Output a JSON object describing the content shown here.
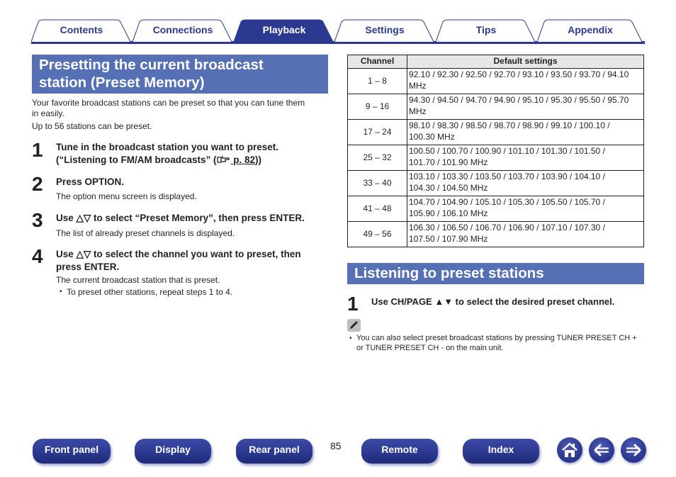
{
  "tabs": [
    {
      "label": "Contents",
      "active": false
    },
    {
      "label": "Connections",
      "active": false
    },
    {
      "label": "Playback",
      "active": true
    },
    {
      "label": "Settings",
      "active": false
    },
    {
      "label": "Tips",
      "active": false
    },
    {
      "label": "Appendix",
      "active": false
    }
  ],
  "left": {
    "heading_line1": "Presetting the current broadcast",
    "heading_line2": "station (Preset Memory)",
    "intro_line1": "Your favorite broadcast stations can be preset so that you can tune them",
    "intro_line2": "in easily.",
    "intro_line3": "Up to 56 stations can be preset.",
    "steps": [
      {
        "num": "1",
        "title_line1": "Tune in the broadcast station you want to preset.",
        "title_line2_pre": "(“Listening to FM/AM broadcasts” (",
        "ref_icon": "pointing-hand-icon",
        "link": " p. 82",
        "title_line2_post": "))"
      },
      {
        "num": "2",
        "title": "Press OPTION.",
        "desc": "The option menu screen is displayed."
      },
      {
        "num": "3",
        "title": "Use △▽ to select “Preset Memory”, then press ENTER.",
        "desc": "The list of already preset channels is displayed."
      },
      {
        "num": "4",
        "title_line1": "Use △▽ to select the channel you want to preset, then",
        "title_line2": "press ENTER.",
        "desc": "The current broadcast station that is preset.",
        "bullet": "To preset other stations, repeat steps 1 to 4."
      }
    ]
  },
  "table": {
    "headers": [
      "Channel",
      "Default settings"
    ],
    "rows": [
      {
        "channel": "1 – 8",
        "line1": "92.10 / 92.30 / 92.50 / 92.70 / 93.10 / 93.50 / 93.70 / 94.10",
        "line2": "MHz"
      },
      {
        "channel": "9 – 16",
        "line1": "94.30 / 94.50 / 94.70 / 94.90 / 95.10 / 95.30 / 95.50 / 95.70",
        "line2": "MHz"
      },
      {
        "channel": "17 – 24",
        "line1": "98.10 / 98.30 / 98.50 / 98.70 / 98.90 / 99.10 / 100.10 /",
        "line2": "100.30 MHz"
      },
      {
        "channel": "25 – 32",
        "line1": "100.50 / 100.70 / 100.90 / 101.10 / 101.30 / 101.50 /",
        "line2": "101.70 / 101.90 MHz"
      },
      {
        "channel": "33 – 40",
        "line1": "103.10 / 103.30 / 103.50 / 103.70 / 103.90 / 104.10 /",
        "line2": "104.30 / 104.50 MHz"
      },
      {
        "channel": "41 – 48",
        "line1": "104.70 / 104.90 / 105.10 / 105.30 / 105.50 / 105.70 /",
        "line2": "105.90 / 106.10 MHz"
      },
      {
        "channel": "49 – 56",
        "line1": "106.30 / 106.50 / 106.70 / 106.90 / 107.10 / 107.30 /",
        "line2": "107.50 / 107.90 MHz"
      }
    ]
  },
  "right": {
    "heading": "Listening to preset stations",
    "step_num": "1",
    "step_title": "Use CH/PAGE ▲▼ to select the desired preset channel.",
    "note_icon": "pencil-icon",
    "note_line1": "You can also select preset broadcast stations by pressing TUNER PRESET CH +",
    "note_line2": "or TUNER PRESET CH - on the main unit."
  },
  "footer": {
    "buttons": [
      "Front panel",
      "Display",
      "Rear panel",
      "Remote",
      "Index"
    ],
    "page_number": "85",
    "icons": [
      "home-icon",
      "back-arrow-icon",
      "forward-arrow-icon"
    ]
  },
  "colors": {
    "brand": "#2b3990",
    "section_header": "#5670b5",
    "table_header": "#e6e7e8"
  }
}
